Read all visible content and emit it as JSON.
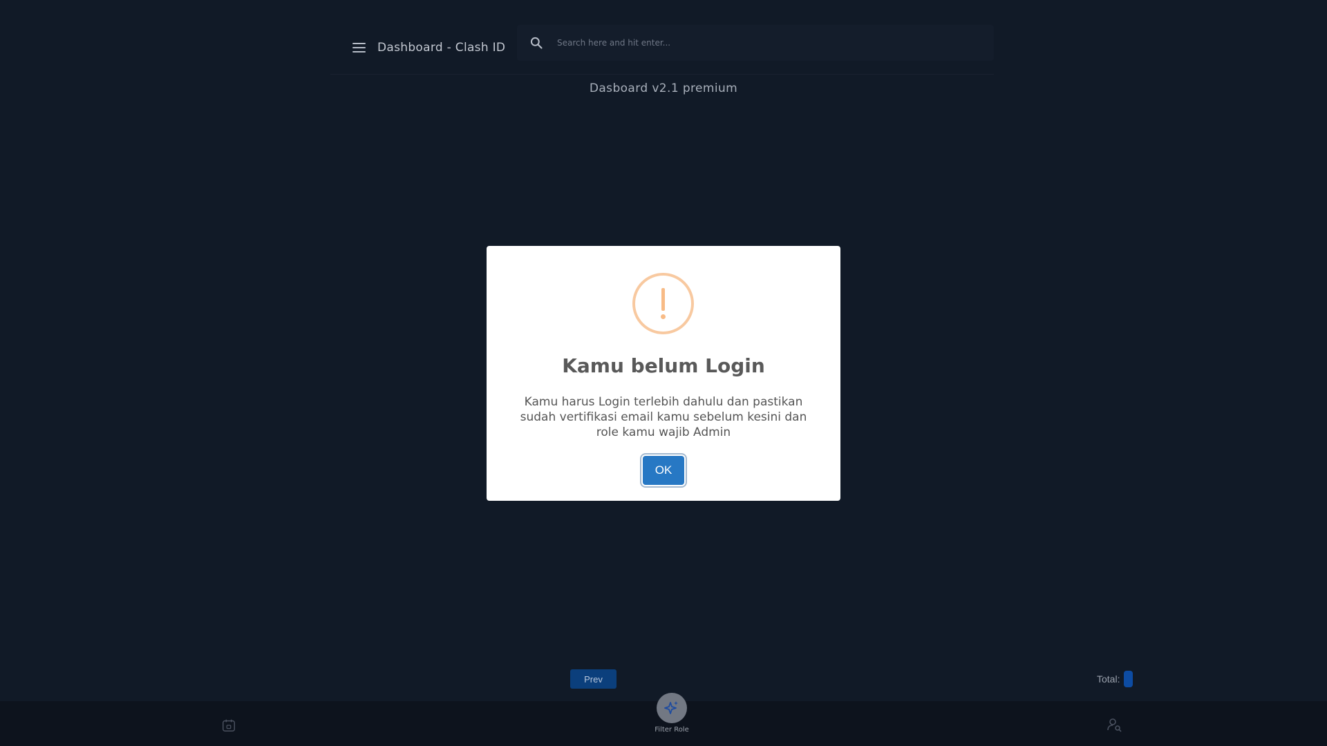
{
  "header": {
    "title": "Dashboard - Clash ID",
    "search_placeholder": "Search here and hit enter..."
  },
  "version_text": "Dasboard v2.1 premium",
  "pagination": {
    "prev_label": "Prev",
    "total_label": "Total:"
  },
  "bottom_nav": {
    "center_label": "Filter Role"
  },
  "modal": {
    "title": "Kamu belum Login",
    "message": "Kamu harus Login terlebih dahulu dan pastikan sudah vertifikasi email kamu sebelum kesini dan role kamu wajib Admin",
    "ok_label": "OK"
  },
  "colors": {
    "background": "#111a27",
    "primary_button": "#2778c4",
    "warning": "#f8bb86",
    "fab": "#727883"
  }
}
